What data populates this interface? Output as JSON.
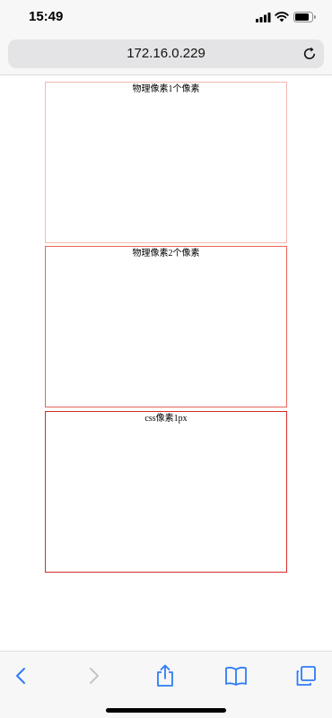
{
  "status_bar": {
    "time": "15:49"
  },
  "url_bar": {
    "url": "172.16.0.229"
  },
  "boxes": [
    {
      "label": "物理像素1个像素"
    },
    {
      "label": "物理像素2个像素"
    },
    {
      "label": "css像素1px"
    }
  ],
  "colors": {
    "accent": "#2f7cf6",
    "box1_border": "#f5b8b0",
    "box2_border": "#e9645a",
    "box3_border": "#d42a2a"
  },
  "icons": [
    "signal-icon",
    "wifi-icon",
    "battery-icon",
    "reload-icon",
    "back-icon",
    "forward-icon",
    "share-icon",
    "bookmarks-icon",
    "tabs-icon"
  ]
}
